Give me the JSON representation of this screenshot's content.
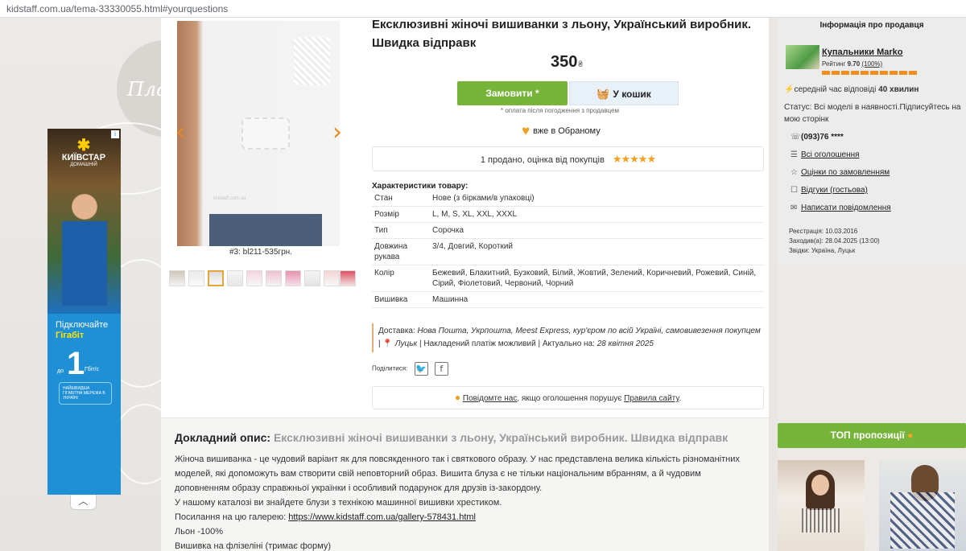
{
  "browser": {
    "url": "kidstaff.com.ua/tema-33330055.html#yourquestions"
  },
  "background": {
    "text": "Пла"
  },
  "ad": {
    "close_label": "i",
    "brand": "КИЇВСТАР",
    "brand_sub": "ДОМАШНІЙ",
    "headline_1": "Підключайте",
    "headline_2": "Гігабіт",
    "speed_prefix": "до",
    "speed_value": "1",
    "speed_unit": "Гбіт/с",
    "note": "НАЙШВИДША ГІГАБІТНА МЕРЕЖА В УКРАЇНІ",
    "collapse_icon": "chevron-up-icon"
  },
  "gallery": {
    "watermark": "kidstaff.com.ua",
    "caption": "#3: bl211-535грн.",
    "thumb_count": 10,
    "active_thumb": 3
  },
  "product": {
    "title": "Ексклюзивні жіночі вишиванки з льону, Український виробник. Швидка відправк",
    "price": "350",
    "currency": "₴",
    "order_button": "Замовити *",
    "cart_button": "У кошик",
    "payment_note": "* оплата після погодження з продавцем",
    "favorite": "вже в Обраному",
    "sold_text": "1 продано, оцінка від покупців",
    "stars": "★★★★★"
  },
  "specs": {
    "title": "Характеристики товару:",
    "rows": [
      {
        "key": "Стан",
        "value": "Нове (з бірками/в упаковці)"
      },
      {
        "key": "Розмір",
        "value": "L, M, S, XL, XXL, XXXL"
      },
      {
        "key": "Тип",
        "value": "Сорочка"
      },
      {
        "key": "Довжина рукава",
        "value": "3/4, Довгий, Короткий"
      },
      {
        "key": "Колір",
        "value": "Бежевий, Блакитний, Бузковий, Білий, Жовтий, Зелений, Коричневий, Рожевий, Синій, Сірий, Фіолетовий, Червоний, Чорний"
      },
      {
        "key": "Вишивка",
        "value": "Машинна"
      }
    ]
  },
  "delivery": {
    "label": "Доставка:",
    "methods": "Нова Пошта, Укрпошта, Meest Express, кур'єром по всій Україні, самовивезення покупцем",
    "city": "Луцьк",
    "cod": "Накладений платіж можливий",
    "actual_label": "Актуально на:",
    "actual_date": "28 квітня 2025"
  },
  "share": {
    "label": "Поділитися:",
    "twitter": "🐦",
    "facebook": "f"
  },
  "report": {
    "link": "Повідомте нас",
    "middle": ", якщо оголошення порушує ",
    "rules": "Правила сайту",
    "end": "."
  },
  "description": {
    "heading": "Докладний опис:",
    "heading_title": "Ексклюзивні жіночі вишиванки з льону, Український виробник. Швидка відправк",
    "p1": "Жіноча вишиванка - це чудовий варіант як для повсякденного так і святкового образу. У нас представлена велика кількість різноманітних моделей, які допоможуть вам створити свій неповторний образ. Вишита блуза є не тільки національним вбранням, а й чудовим доповненням образу справжньої українки і особливий подарунок для друзів із-закордону.",
    "p2": "У нашому каталозі ви знайдете блузи з технікою машинної вишивки хрестиком.",
    "link_label": "Посилання на цю галерею:",
    "link": "https://www.kidstaff.com.ua/gallery-578431.html",
    "p3": "Льон -100%",
    "p4": "Вишивка на флізеліні (тримає форму)"
  },
  "seller": {
    "header": "Інформація про продавця",
    "name": "Купальники Marko",
    "rating_label": "Рейтинг",
    "rating_value": "9.70",
    "rating_percent": "(100%)",
    "response_label": "середній час відповіді",
    "response_value": "40 хвилин",
    "status": "Статус: Всі моделі в наявності.Підписуйтесь на мою сторінк",
    "phone": "(093)76 ****",
    "all_ads": "Всі оголошення",
    "order_reviews": "Оцінки по замовленням",
    "guest_reviews": "Відгуки (гостьова)",
    "write_message": "Написати повідомлення",
    "registration": "Реєстрація: 10.03.2016",
    "last_visit": "Заходив(а): 28.04.2025 (13:00)",
    "from": "Звідки: Україна, Луцьк"
  },
  "top_offers": {
    "label": "ТОП пропозиції",
    "badge": "i"
  }
}
